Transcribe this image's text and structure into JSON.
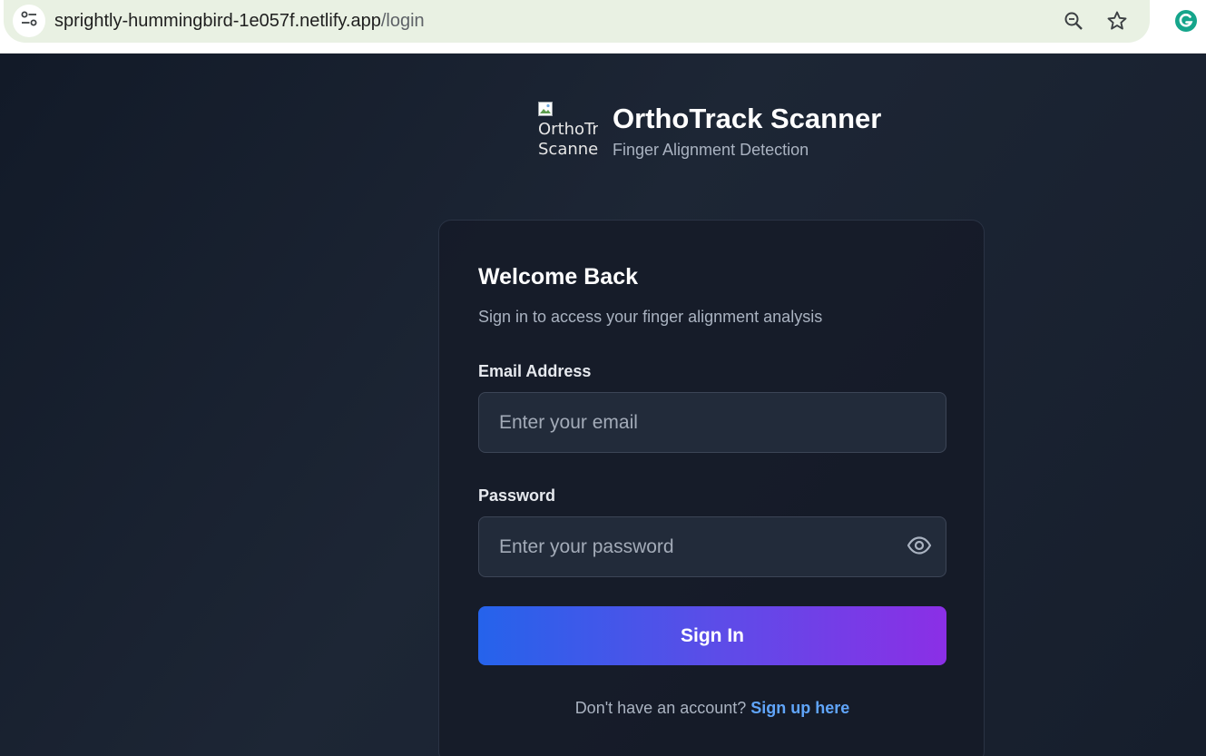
{
  "browser": {
    "url_host": "sprightly-hummingbird-1e057f.netlify.app",
    "url_path": "/login",
    "icons": [
      "tune-icon",
      "zoom-icon",
      "star-icon",
      "grammarly-icon"
    ]
  },
  "brand": {
    "logo_alt": "OrthoTrack Scanner Logo",
    "title": "OrthoTrack Scanner",
    "subtitle": "Finger Alignment Detection"
  },
  "login": {
    "title": "Welcome Back",
    "subtitle": "Sign in to access your finger alignment analysis",
    "email_label": "Email Address",
    "email_placeholder": "Enter your email",
    "email_value": "",
    "password_label": "Password",
    "password_placeholder": "Enter your password",
    "password_value": "",
    "password_toggle_icon": "eye-icon",
    "submit_label": "Sign In",
    "signup_prompt": "Don't have an account?",
    "signup_link": "Sign up here"
  },
  "colors": {
    "background": "#1a2230",
    "accent_start": "#2563eb",
    "accent_end": "#8b2fe6",
    "link": "#60a5fa"
  }
}
